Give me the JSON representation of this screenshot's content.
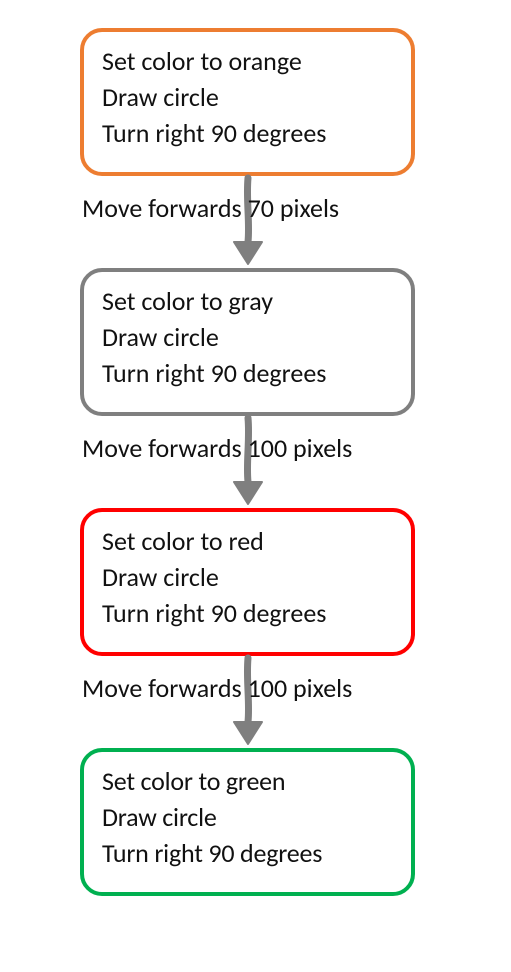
{
  "diagram": {
    "nodes": [
      {
        "id": "node-orange",
        "border_color": "#ed7d31",
        "lines": [
          "Set color to orange",
          "Draw circle",
          "Turn right 90 degrees"
        ]
      },
      {
        "id": "node-gray",
        "border_color": "#7f7f7f",
        "lines": [
          "Set color to gray",
          "Draw circle",
          "Turn right 90 degrees"
        ]
      },
      {
        "id": "node-red",
        "border_color": "#ff0000",
        "lines": [
          "Set color to red",
          "Draw circle",
          "Turn right 90 degrees"
        ]
      },
      {
        "id": "node-green",
        "border_color": "#00b050",
        "lines": [
          "Set color to green",
          "Draw circle",
          "Turn right 90 degrees"
        ]
      }
    ],
    "edges": [
      {
        "from": "node-orange",
        "to": "node-gray",
        "label": "Move forwards 70 pixels"
      },
      {
        "from": "node-gray",
        "to": "node-red",
        "label": "Move forwards 100 pixels"
      },
      {
        "from": "node-red",
        "to": "node-green",
        "label": "Move forwards 100 pixels"
      }
    ],
    "arrow_color": "#7f7f7f"
  }
}
